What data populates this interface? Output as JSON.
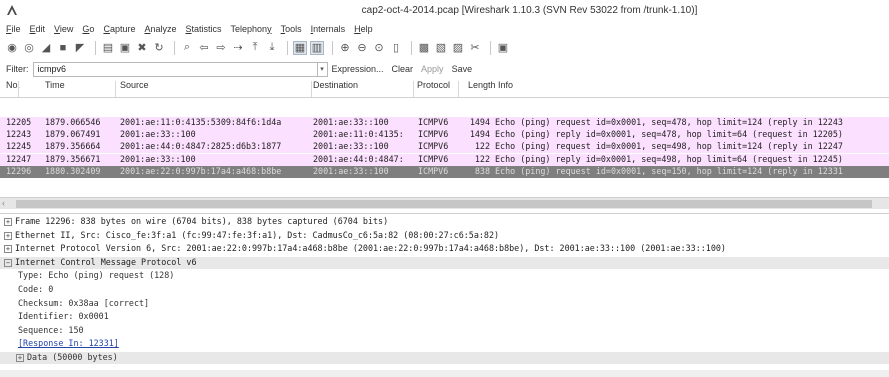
{
  "window": {
    "title": "cap2-oct-4-2014.pcap  [Wireshark 1.10.3  (SVN Rev 53022 from /trunk-1.10)]"
  },
  "menu": [
    {
      "pre": "",
      "u": "F",
      "post": "ile"
    },
    {
      "pre": "",
      "u": "E",
      "post": "dit"
    },
    {
      "pre": "",
      "u": "V",
      "post": "iew"
    },
    {
      "pre": "",
      "u": "G",
      "post": "o"
    },
    {
      "pre": "",
      "u": "C",
      "post": "apture"
    },
    {
      "pre": "",
      "u": "A",
      "post": "nalyze"
    },
    {
      "pre": "",
      "u": "S",
      "post": "tatistics"
    },
    {
      "pre": "Telephon",
      "u": "y",
      "post": ""
    },
    {
      "pre": "",
      "u": "T",
      "post": "ools"
    },
    {
      "pre": "",
      "u": "I",
      "post": "nternals"
    },
    {
      "pre": "",
      "u": "H",
      "post": "elp"
    }
  ],
  "toolbar": {
    "icons": [
      "interface-list-icon",
      "capture-options-icon",
      "start-capture-icon",
      "stop-capture-icon",
      "restart-capture-icon",
      "open-file-icon",
      "save-file-icon",
      "close-file-icon",
      "reload-icon",
      "find-packet-icon",
      "go-back-icon",
      "go-forward-icon",
      "go-to-packet-icon",
      "go-first-icon",
      "go-last-icon",
      "colorize-icon",
      "autoscroll-icon",
      "zoom-in-icon",
      "zoom-out-icon",
      "normal-size-icon",
      "resize-columns-icon",
      "capture-filters-icon",
      "display-filters-icon",
      "coloring-rules-icon",
      "preferences-icon",
      "help-icon"
    ],
    "glyphs": [
      "◉",
      "◎",
      "◢",
      "■",
      "◤",
      "▤",
      "▣",
      "✖",
      "↻",
      "⌕",
      "⇦",
      "⇨",
      "⇢",
      "⤒",
      "⤓",
      "▦",
      "▥",
      "⊕",
      "⊖",
      "⊙",
      "▯",
      "▩",
      "▧",
      "▨",
      "✂",
      "▣"
    ]
  },
  "filter": {
    "label": "Filter:",
    "value": "icmpv6",
    "expression_label": "Expression...",
    "clear_label": "Clear",
    "apply_label": "Apply",
    "save_label": "Save"
  },
  "packet_list": {
    "headers": {
      "no": "No.",
      "time": "Time",
      "source": "Source",
      "destination": "Destination",
      "protocol": "Protocol",
      "length_info": "Length  Info"
    },
    "rows": [
      {
        "no": "12205",
        "time": "1879.066546",
        "source": "2001:ae:11:0:4135:5309:84f6:1d4a",
        "destination": "2001:ae:33::100",
        "protocol": "ICMPV6",
        "length": "1494",
        "info": "Echo (ping) request id=0x0001, seq=478, hop limit=124 (reply in 12243",
        "style": "icmp"
      },
      {
        "no": "12243",
        "time": "1879.067491",
        "source": "2001:ae:33::100",
        "destination": "2001:ae:11:0:4135:",
        "protocol": "ICMPV6",
        "length": "1494",
        "info": "Echo (ping) reply id=0x0001, seq=478, hop limit=64 (request in 12205)",
        "style": "icmp"
      },
      {
        "no": "12245",
        "time": "1879.356664",
        "source": "2001:ae:44:0:4847:2825:d6b3:1877",
        "destination": "2001:ae:33::100",
        "protocol": "ICMPV6",
        "length": "122",
        "info": "Echo (ping) request id=0x0001, seq=498, hop limit=124 (reply in 12247",
        "style": "icmp"
      },
      {
        "no": "12247",
        "time": "1879.356671",
        "source": "2001:ae:33::100",
        "destination": "2001:ae:44:0:4847:",
        "protocol": "ICMPV6",
        "length": "122",
        "info": "Echo (ping) reply id=0x0001, seq=498, hop limit=64 (request in 12245)",
        "style": "icmp"
      },
      {
        "no": "12296",
        "time": "1880.302409",
        "source": "2001:ae:22:0:997b:17a4:a468:b8be",
        "destination": "2001:ae:33::100",
        "protocol": "ICMPV6",
        "length": "838",
        "info": "Echo (ping) request id=0x0001, seq=150, hop limit=124 (reply in 12331",
        "style": "selected"
      }
    ]
  },
  "details": [
    {
      "exp": "⊞",
      "text": "Frame 12296: 838 bytes on wire (6704 bits), 838 bytes captured (6704 bits)",
      "level": 0,
      "hl": false
    },
    {
      "exp": "⊞",
      "text": "Ethernet II, Src: Cisco_fe:3f:a1 (fc:99:47:fe:3f:a1), Dst: CadmusCo_c6:5a:82 (08:00:27:c6:5a:82)",
      "level": 0,
      "hl": false
    },
    {
      "exp": "⊞",
      "text": "Internet Protocol Version 6, Src: 2001:ae:22:0:997b:17a4:a468:b8be (2001:ae:22:0:997b:17a4:a468:b8be), Dst: 2001:ae:33::100 (2001:ae:33::100)",
      "level": 0,
      "hl": false
    },
    {
      "exp": "⊟",
      "text": "Internet Control Message Protocol v6",
      "level": 0,
      "hl": true
    },
    {
      "exp": "",
      "text": "Type: Echo (ping) request (128)",
      "level": 1,
      "hl": false
    },
    {
      "exp": "",
      "text": "Code: 0",
      "level": 1,
      "hl": false
    },
    {
      "exp": "",
      "text": "Checksum: 0x38aa [correct]",
      "level": 1,
      "hl": false
    },
    {
      "exp": "",
      "text": "Identifier: 0x0001",
      "level": 1,
      "hl": false
    },
    {
      "exp": "",
      "text": "Sequence: 150",
      "level": 1,
      "hl": false
    },
    {
      "exp": "",
      "text": "[Response In: 12331]",
      "level": 1,
      "hl": false,
      "link": true
    },
    {
      "exp": "⊞",
      "text": "Data (50000 bytes)",
      "level": 1,
      "hl": true
    }
  ],
  "colors": {
    "icmp_row": "#fce0ff",
    "selected_row": "#7f7f7f",
    "highlight_row": "#e8e8e8"
  }
}
